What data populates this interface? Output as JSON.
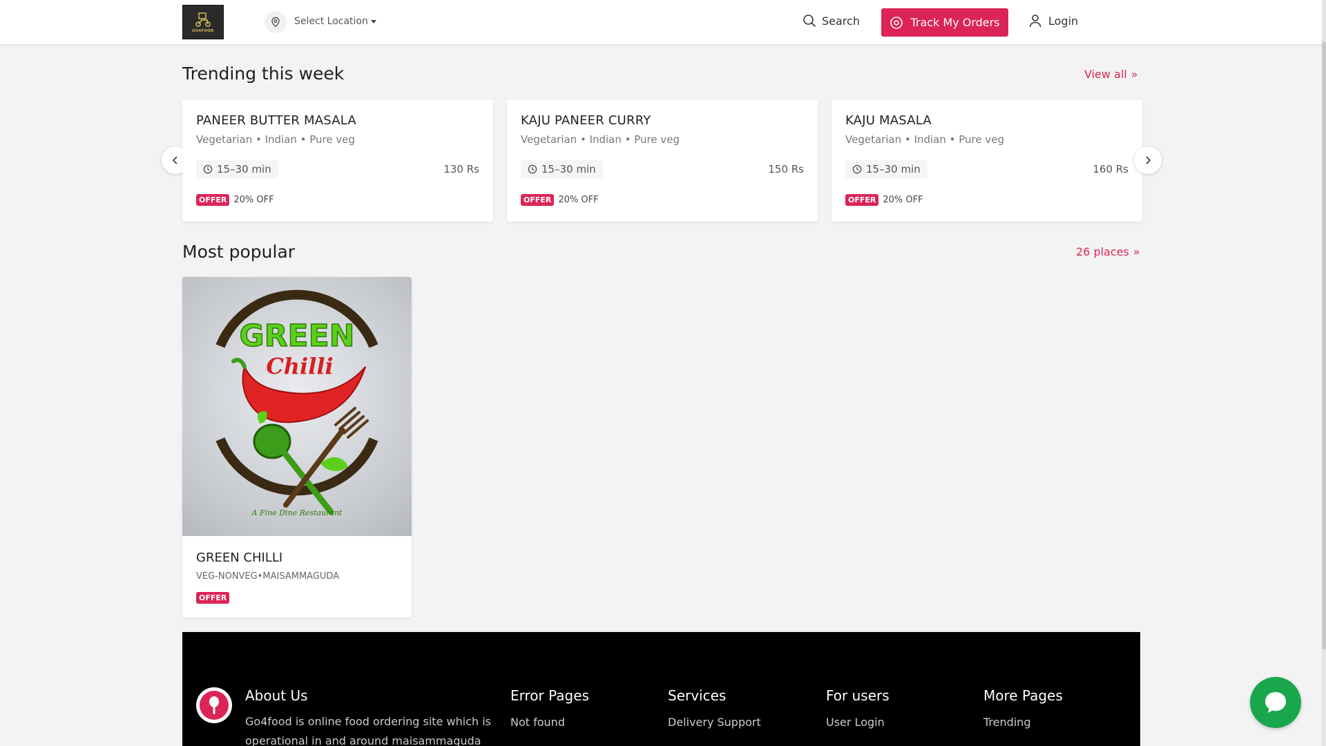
{
  "header": {
    "logo_text": "GO4FOOD",
    "location_label": "Select Location",
    "search_label": "Search",
    "track_label": "Track My Orders",
    "login_label": "Login",
    "accent_color": "#dc2457"
  },
  "trending": {
    "title": "Trending this week",
    "view_all": "View all",
    "cards": [
      {
        "name": "PANEER BUTTER MASALA",
        "tags": "Vegetarian • Indian • Pure veg",
        "time": "15–30 min",
        "price": "130 Rs",
        "offer_badge": "OFFER",
        "offer_text": "20% OFF"
      },
      {
        "name": "KAJU PANEER CURRY",
        "tags": "Vegetarian • Indian • Pure veg",
        "time": "15–30 min",
        "price": "150 Rs",
        "offer_badge": "OFFER",
        "offer_text": "20% OFF"
      },
      {
        "name": "KAJU MASALA",
        "tags": "Vegetarian • Indian • Pure veg",
        "time": "15–30 min",
        "price": "160 Rs",
        "offer_badge": "OFFER",
        "offer_text": "20% OFF"
      }
    ]
  },
  "popular": {
    "title": "Most popular",
    "places_link": "26 places",
    "items": [
      {
        "name": "GREEN CHILLI",
        "tags": "VEG-NONVEG•MAISAMMAGUDA",
        "offer_badge": "OFFER",
        "logo_word1": "GREEN",
        "logo_word2": "Chilli",
        "logo_tagline": "A Fine Dine Restaurant"
      }
    ]
  },
  "footer": {
    "about_title": "About Us",
    "about_text": "Go4food is online food ordering site which is operational in and around maisammaguda",
    "columns": [
      {
        "title": "Error Pages",
        "items": [
          "Not found"
        ]
      },
      {
        "title": "Services",
        "items": [
          "Delivery Support"
        ]
      },
      {
        "title": "For users",
        "items": [
          "User Login"
        ]
      },
      {
        "title": "More Pages",
        "items": [
          "Trending"
        ]
      }
    ]
  },
  "icons": {
    "location": "location-pin-icon",
    "search": "search-icon",
    "track": "target-icon",
    "login": "user-icon",
    "time": "clock-icon",
    "chat": "chat-bubble-icon"
  }
}
